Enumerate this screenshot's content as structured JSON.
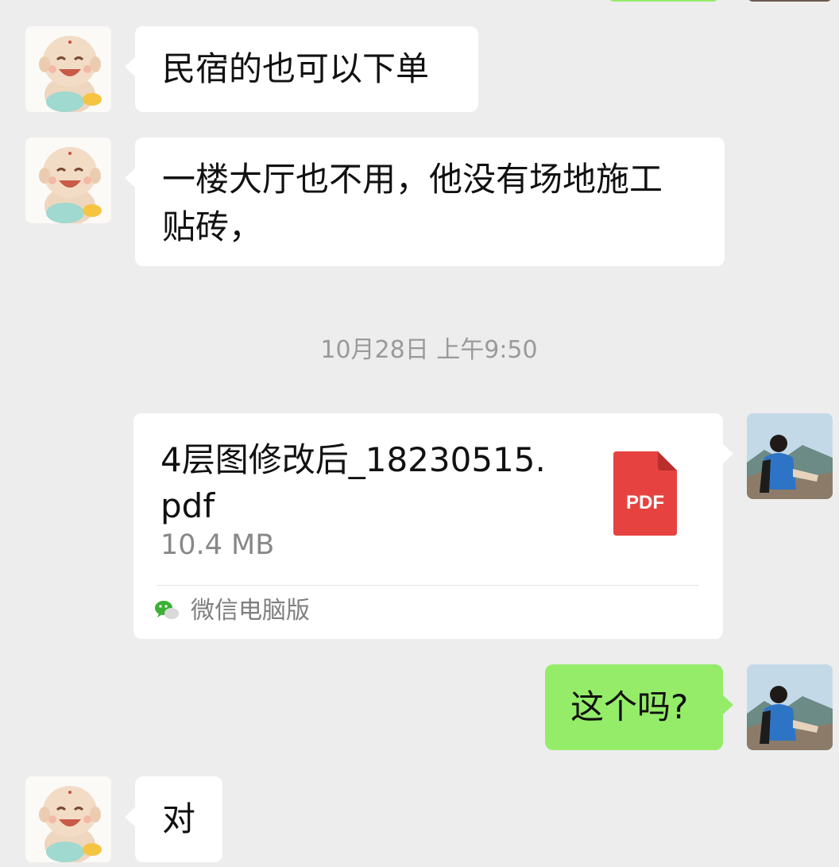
{
  "messages": [
    {
      "sender": "contact",
      "text": "民宿的也可以下单"
    },
    {
      "sender": "contact",
      "lines": [
        "一楼大厅也不用，他没有场地施工",
        "贴砖，"
      ]
    },
    {
      "timestamp": "10月28日 上午9:50"
    },
    {
      "sender": "self",
      "file": {
        "name_line1": "4层图修改后_18230515.",
        "name_line2": "pdf",
        "size": "10.4 MB",
        "type_badge": "PDF",
        "source": "微信电脑版"
      }
    },
    {
      "sender": "self",
      "text": "这个吗?"
    },
    {
      "sender": "contact",
      "text": "对"
    }
  ],
  "icons": {
    "contact_avatar": "laughing-buddha-avatar",
    "self_avatar": "mountain-hiker-avatar",
    "file_type": "pdf-icon",
    "source_app": "wechat-icon"
  },
  "colors": {
    "background": "#ededed",
    "bubble_incoming": "#ffffff",
    "bubble_outgoing": "#95ec69",
    "pdf_red": "#e64340",
    "timestamp_gray": "#9a9a9a"
  }
}
